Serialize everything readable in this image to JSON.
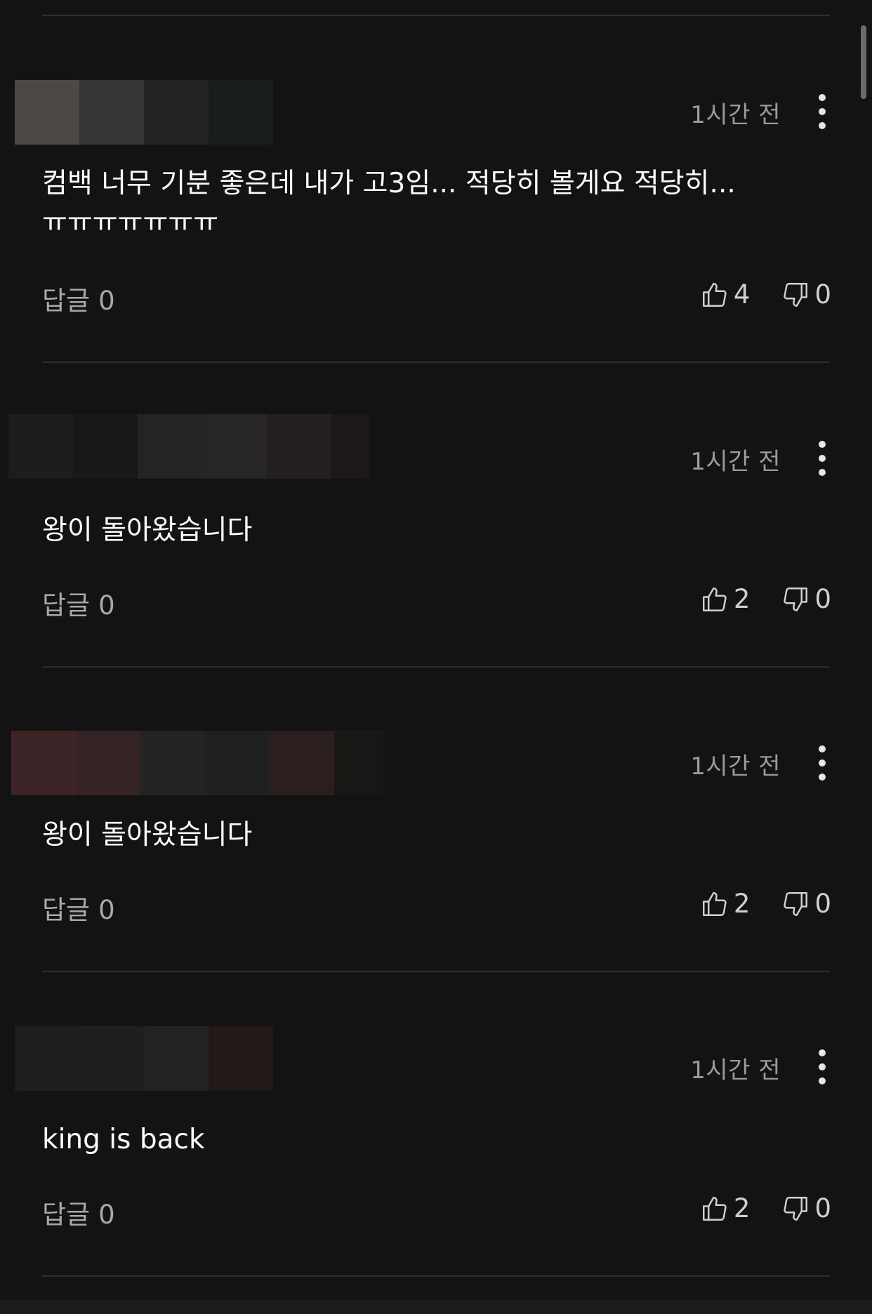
{
  "comments": [
    {
      "timestamp": "1시간 전",
      "text": "컴백 너무 기분 좋은데 내가 고3임... 적당히 볼게요 적당히...ㅠㅠㅠㅠㅠㅠㅠ",
      "reply_label": "답글",
      "reply_count": "0",
      "likes": "4",
      "dislikes": "0",
      "avatar_colors": [
        "#4b4846",
        "#363534",
        "#232323",
        "#1a1e1a"
      ]
    },
    {
      "timestamp": "1시간 전",
      "text": "왕이 돌아왔습니다",
      "reply_label": "답글",
      "reply_count": "0",
      "likes": "2",
      "dislikes": "0",
      "avatar_colors": [
        "#1d1d1d",
        "#181818",
        "#242424",
        "#262626",
        "#241e1e",
        "#1d1818"
      ]
    },
    {
      "timestamp": "1시간 전",
      "text": "왕이 돌아왔습니다",
      "reply_label": "답글",
      "reply_count": "0",
      "likes": "2",
      "dislikes": "0",
      "avatar_colors": [
        "#3d2426",
        "#332324",
        "#232323",
        "#202020",
        "#2b1e1e",
        "#191616"
      ]
    },
    {
      "timestamp": "1시간 전",
      "text": "king is back",
      "reply_label": "답글",
      "reply_count": "0",
      "likes": "2",
      "dislikes": "0",
      "avatar_colors": [
        "#1e1e1e",
        "#1f1f1f",
        "#232323",
        "#231919"
      ]
    }
  ],
  "icons": {
    "like": "thumbs-up-icon",
    "dislike": "thumbs-down-icon",
    "more": "more-vert-icon"
  },
  "colors": {
    "background": "#131313",
    "divider": "#2e2e2e",
    "secondary_text": "#a8a8a8"
  }
}
